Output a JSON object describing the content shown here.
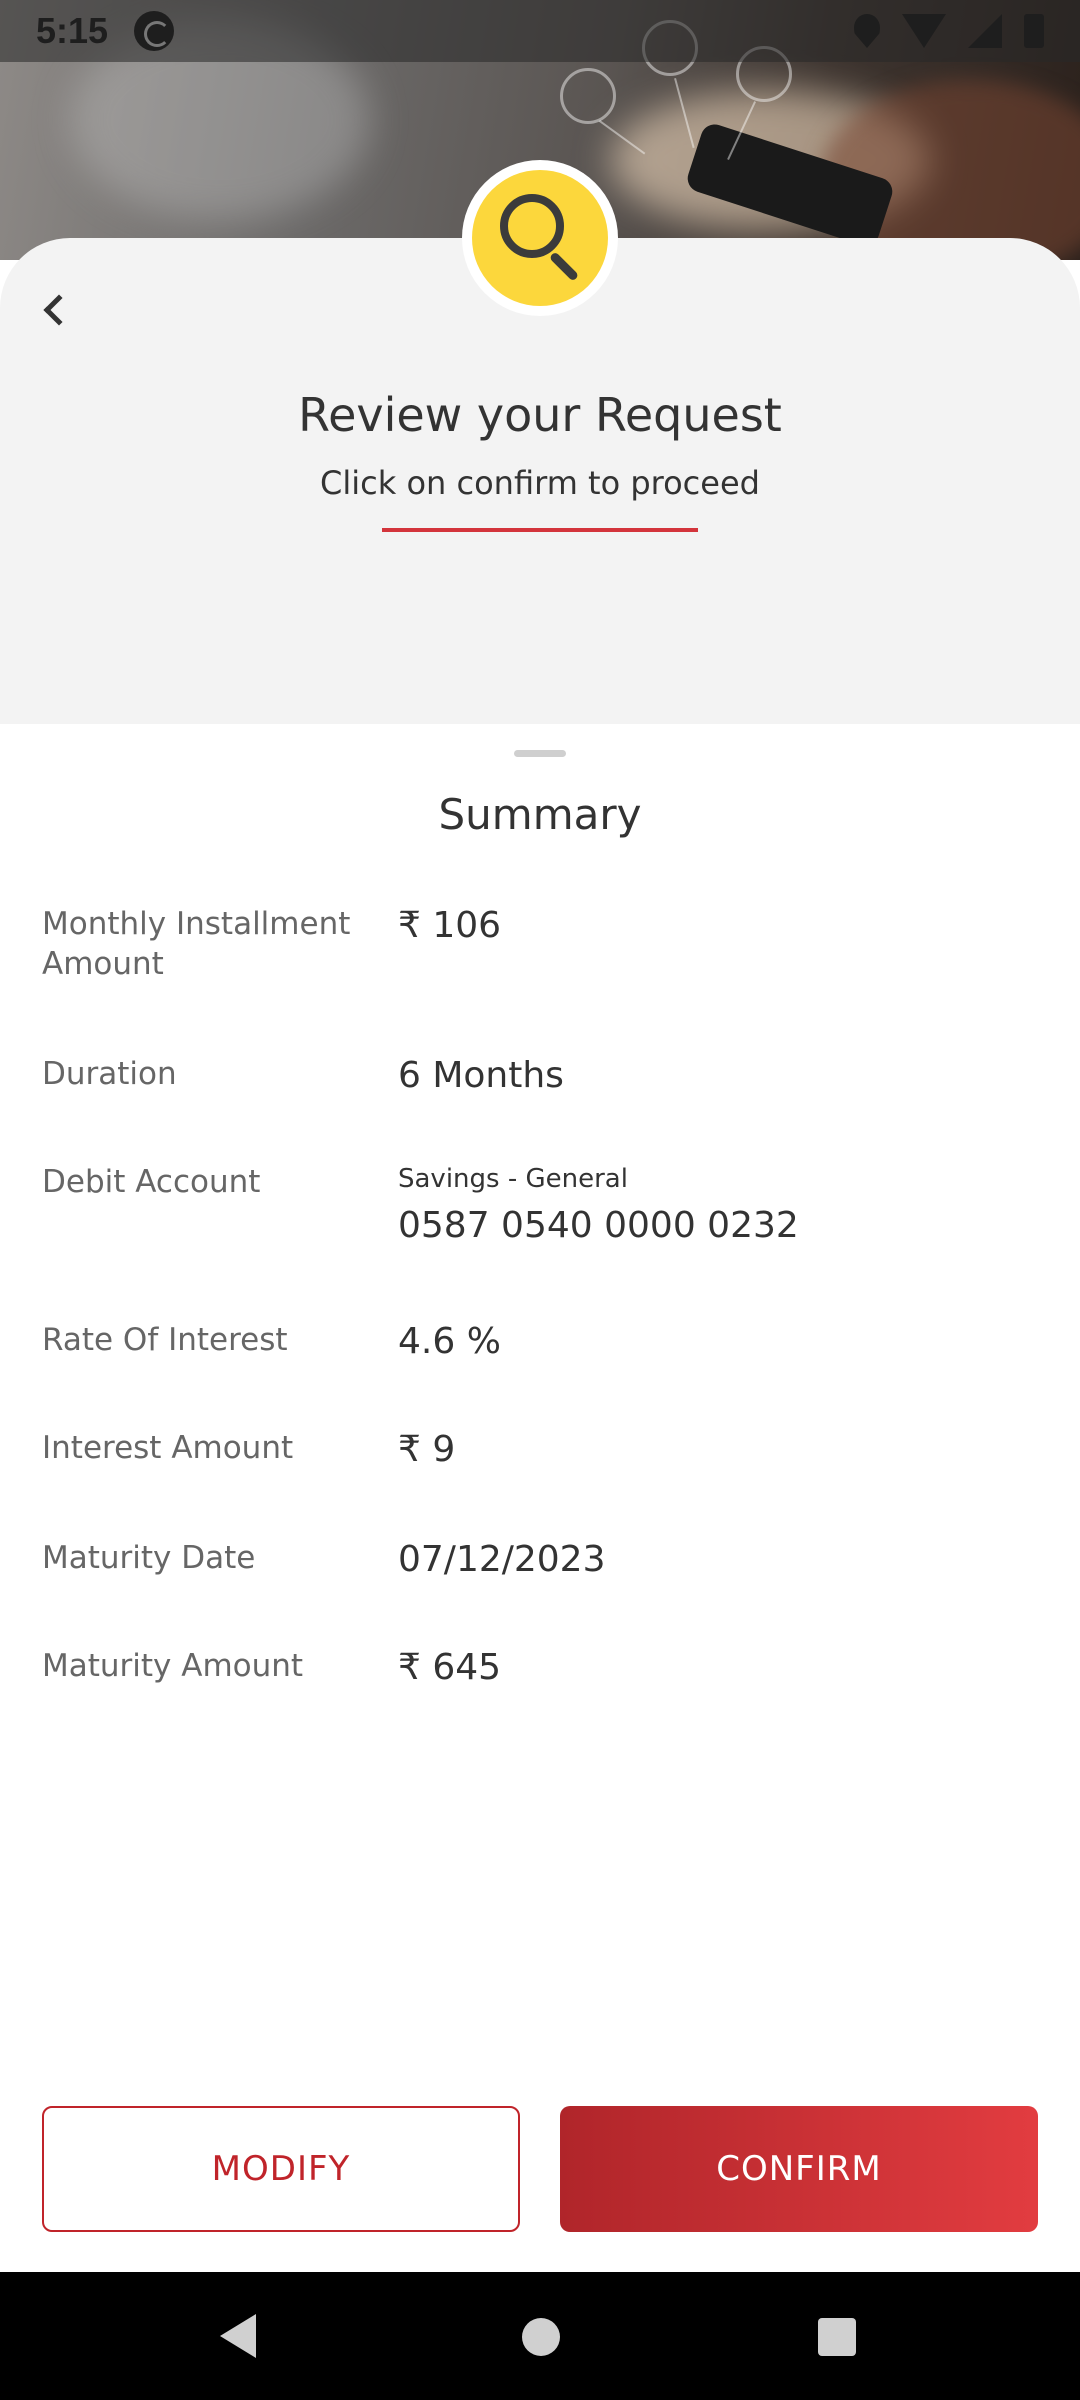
{
  "status_bar": {
    "time": "5:15",
    "icons": [
      "app-sync-icon",
      "location-icon",
      "wifi-icon",
      "signal-icon",
      "battery-icon"
    ]
  },
  "header": {
    "badge_icon": "search-icon",
    "title": "Review your Request",
    "subtitle": "Click on confirm to proceed",
    "accent_color": "#d3343b"
  },
  "summary": {
    "title": "Summary",
    "rows": [
      {
        "label": "Monthly Installment Amount",
        "value": "₹ 106"
      },
      {
        "label": "Duration",
        "value": "6 Months"
      },
      {
        "label": "Debit Account",
        "account_type": "Savings - General",
        "value": "0587 0540 0000 0232"
      },
      {
        "label": "Rate Of Interest",
        "value": "4.6 %"
      },
      {
        "label": "Interest Amount",
        "value": "₹ 9"
      },
      {
        "label": "Maturity Date",
        "value": "07/12/2023"
      },
      {
        "label": "Maturity Amount",
        "value": "₹ 645"
      }
    ]
  },
  "actions": {
    "modify_label": "MODIFY",
    "confirm_label": "CONFIRM",
    "primary_color": "#c0242a"
  },
  "nav_bar": {
    "icons": [
      "back-icon",
      "home-icon",
      "recents-icon"
    ]
  }
}
